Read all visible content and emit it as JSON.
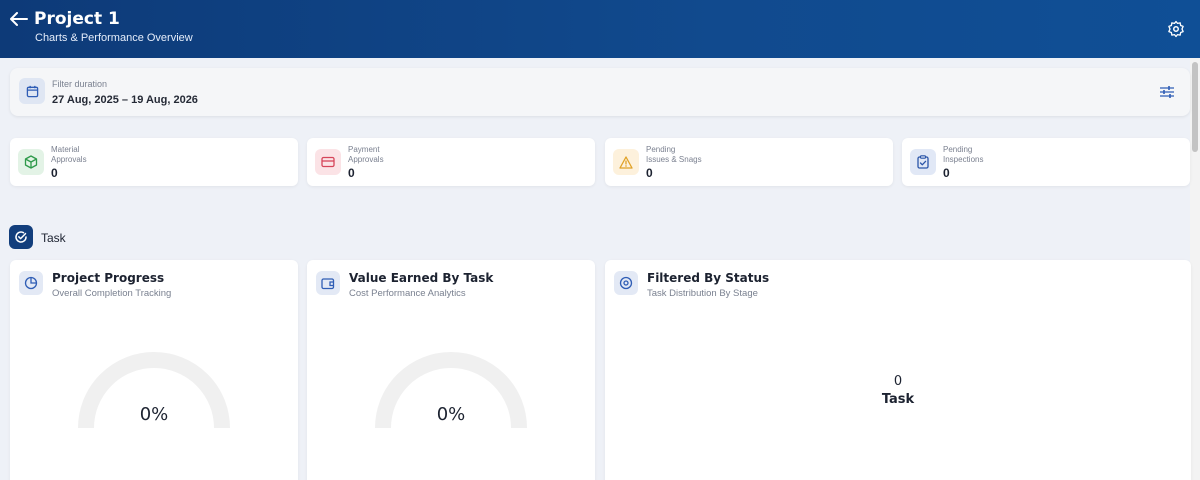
{
  "header": {
    "title": "Project 1",
    "subtitle": "Charts & Performance Overview",
    "back_icon": "arrow-left-icon",
    "settings_icon": "gear-icon"
  },
  "filter": {
    "label": "Filter duration",
    "value": "27 Aug, 2025 – 19 Aug, 2026",
    "icon": "calendar-icon",
    "adjust_icon": "sliders-icon"
  },
  "stats": [
    {
      "label_line1": "Material",
      "label_line2": "Approvals",
      "value": "0",
      "icon": "box-icon",
      "color": "#2e9a4a",
      "bg": "#e3f3e6"
    },
    {
      "label_line1": "Payment",
      "label_line2": "Approvals",
      "value": "0",
      "icon": "card-icon",
      "color": "#d6455a",
      "bg": "#fbe3e6"
    },
    {
      "label_line1": "Pending",
      "label_line2": "Issues & Snags",
      "value": "0",
      "icon": "warning-icon",
      "color": "#e0a126",
      "bg": "#fdf1dc"
    },
    {
      "label_line1": "Pending",
      "label_line2": "Inspections",
      "value": "0",
      "icon": "clipboard-check-icon",
      "color": "#2b55a8",
      "bg": "#e1e8f6"
    }
  ],
  "task_section": {
    "heading": "Task",
    "icon": "check-circle-icon"
  },
  "panels": [
    {
      "title": "Project Progress",
      "subtitle": "Overall Completion Tracking",
      "value": "0%",
      "icon": "pie-chart-icon"
    },
    {
      "title": "Value Earned By Task",
      "subtitle": "Cost Performance Analytics",
      "value": "0%",
      "icon": "wallet-icon"
    },
    {
      "title": "Filtered By Status",
      "subtitle": "Task Distribution By Stage",
      "count": "0",
      "count_label": "Task",
      "icon": "disc-icon"
    }
  ],
  "colors": {
    "header": "#0d3a78",
    "accent": "#123e7c",
    "gauge_track": "#f0f0f0"
  }
}
